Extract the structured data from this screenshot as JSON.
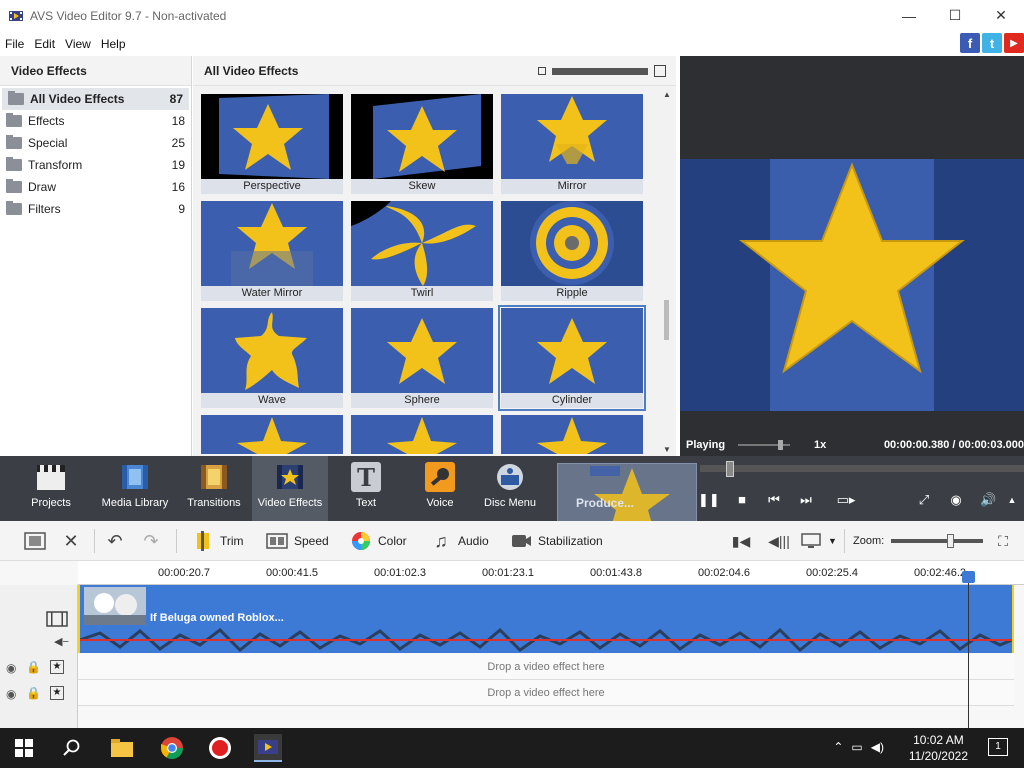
{
  "window": {
    "title": "AVS Video Editor 9.7 - Non-activated",
    "minimize": "—",
    "maximize": "☐",
    "close": "✕"
  },
  "menu": [
    "File",
    "Edit",
    "View",
    "Help"
  ],
  "social": {
    "facebook": "f",
    "twitter": "t",
    "youtube": "▶"
  },
  "categories": {
    "header": "Video Effects",
    "items": [
      {
        "label": "All Video Effects",
        "count": "87"
      },
      {
        "label": "Effects",
        "count": "18"
      },
      {
        "label": "Special",
        "count": "25"
      },
      {
        "label": "Transform",
        "count": "19"
      },
      {
        "label": "Draw",
        "count": "16"
      },
      {
        "label": "Filters",
        "count": "9"
      }
    ]
  },
  "grid": {
    "header": "All Video Effects",
    "tiles": [
      "Perspective",
      "Skew",
      "Mirror",
      "Water Mirror",
      "Twirl",
      "Ripple",
      "Wave",
      "Sphere",
      "Cylinder"
    ],
    "selected": "Cylinder"
  },
  "preview": {
    "status": "Playing",
    "speed": "1x",
    "time": "00:00:00.380 / 00:00:03.000"
  },
  "toolbar": {
    "projects": "Projects",
    "media_library": "Media Library",
    "transitions": "Transitions",
    "video_effects": "Video Effects",
    "text": "Text",
    "voice": "Voice",
    "disc_menu": "Disc Menu",
    "produce": "Produce..."
  },
  "edit_toolbar": {
    "trim": "Trim",
    "speed": "Speed",
    "color": "Color",
    "audio": "Audio",
    "stabilization": "Stabilization",
    "zoom": "Zoom:"
  },
  "timeline": {
    "ticks": [
      "00:00:20.7",
      "00:00:41.5",
      "00:01:02.3",
      "00:01:23.1",
      "00:01:43.8",
      "00:02:04.6",
      "00:02:25.4",
      "00:02:46.2"
    ],
    "clip_title": "If Beluga owned Roblox...",
    "drop_hint_1": "Drop a video effect here",
    "drop_hint_2": "Drop a video effect here"
  },
  "taskbar": {
    "time": "10:02 AM",
    "date": "11/20/2022",
    "notifications": "1"
  },
  "colors": {
    "accent": "#3d7ad6",
    "toolbar_bg": "#3b3f45",
    "star": "#f2c21b",
    "tile_bg": "#2b4d8f"
  }
}
